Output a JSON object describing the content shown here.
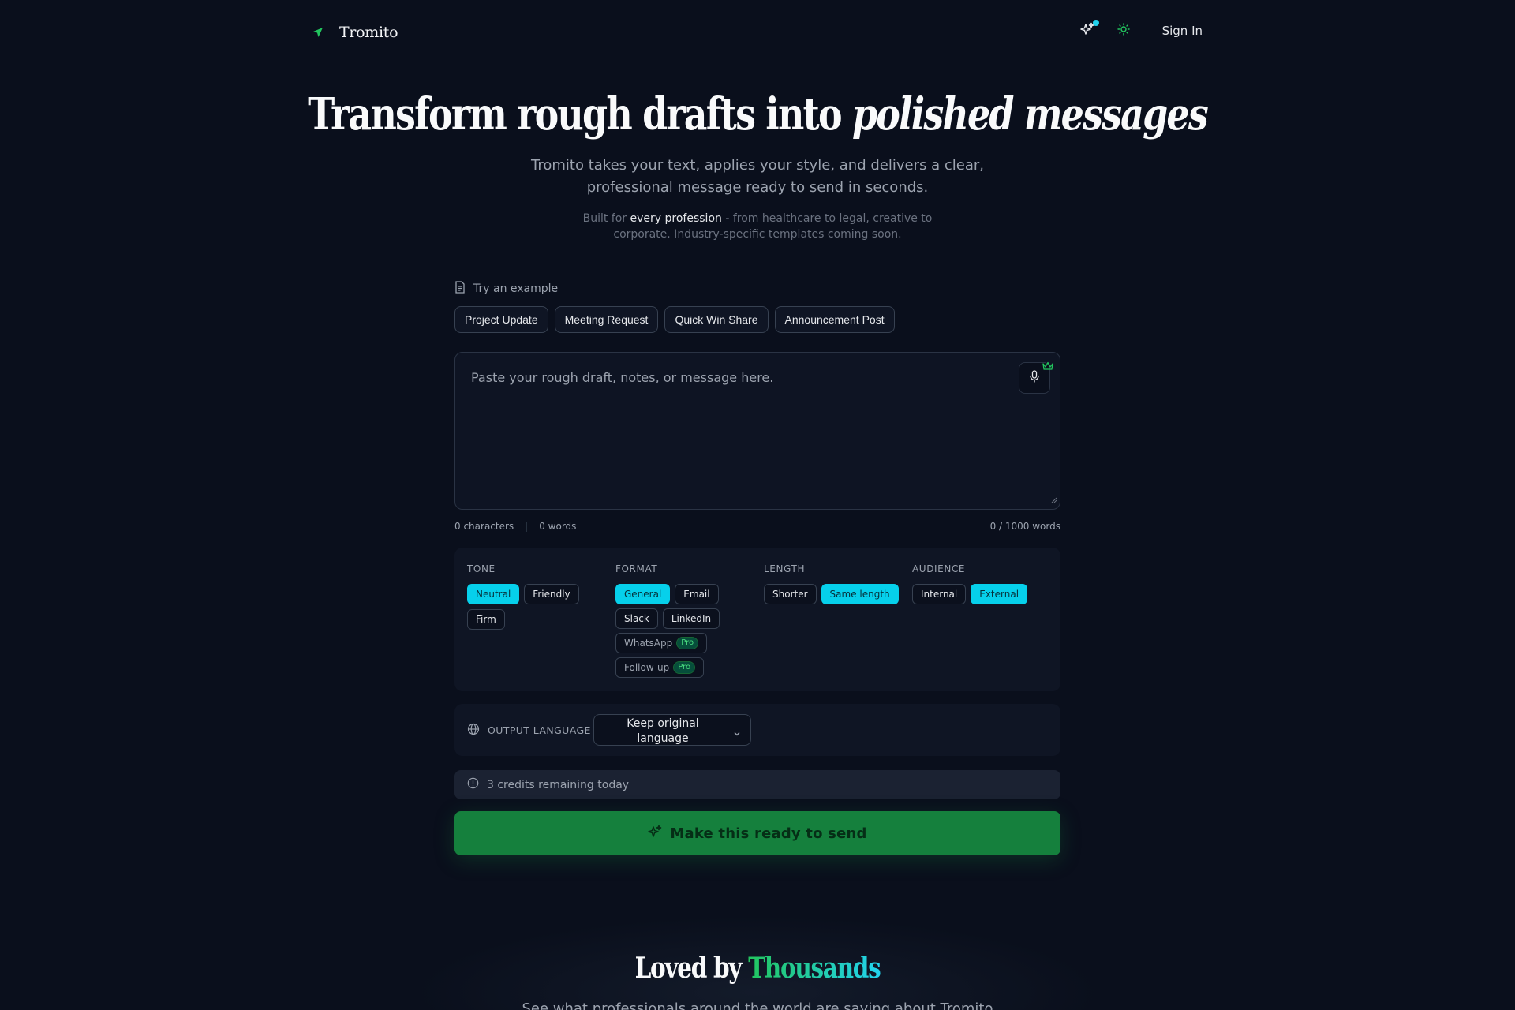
{
  "app": {
    "name": "Tromito"
  },
  "header": {
    "sign_in": "Sign In"
  },
  "hero": {
    "title_plain": "Transform rough drafts into ",
    "title_italic": "polished messages",
    "subtitle": "Tromito takes your text, applies your style, and delivers a clear, professional message ready to send in seconds.",
    "note_prefix": "Built for ",
    "note_highlight": "every profession",
    "note_suffix": " - from healthcare to legal, creative to corporate. Industry-specific templates coming soon."
  },
  "examples": {
    "label": "Try an example",
    "items": [
      "Project Update",
      "Meeting Request",
      "Quick Win Share",
      "Announcement Post"
    ]
  },
  "editor": {
    "placeholder": "Paste your rough draft, notes, or message here.",
    "value": "",
    "characters": "0 characters",
    "words": "0 words",
    "limit": "0 / 1000 words"
  },
  "options": {
    "tone": {
      "title": "TONE",
      "items": [
        "Neutral",
        "Friendly",
        "Firm"
      ],
      "selected": "Neutral"
    },
    "format": {
      "title": "FORMAT",
      "items": [
        "General",
        "Email",
        "Slack",
        "LinkedIn",
        "WhatsApp",
        "Follow-up"
      ],
      "selected": "General",
      "pro_badge": "Pro"
    },
    "length": {
      "title": "LENGTH",
      "items": [
        "Shorter",
        "Same length"
      ],
      "selected": "Same length"
    },
    "audience": {
      "title": "AUDIENCE",
      "items": [
        "Internal",
        "External"
      ],
      "selected": "External"
    }
  },
  "output_language": {
    "label": "OUTPUT LANGUAGE",
    "value": "Keep original language"
  },
  "credits": {
    "text": "3 credits remaining today"
  },
  "cta": {
    "label": "Make this ready to send"
  },
  "testimonials": {
    "title_plain": "Loved by ",
    "title_accent": "Thousands",
    "subtitle": "See what professionals around the world are saying about Tromito"
  },
  "colors": {
    "background": "#0a0f1c",
    "accent_cyan": "#06d0eb",
    "brand_green": "#15803d",
    "pro_green": "#4ade80"
  },
  "icons": {
    "logo": "paper-plane-icon",
    "whats_new": "sparkles-icon",
    "theme": "sun-icon",
    "example": "document-icon",
    "mic": "microphone-icon",
    "premium": "crown-icon",
    "language": "globe-icon",
    "credits": "info-icon",
    "cta": "sparkles-icon"
  }
}
